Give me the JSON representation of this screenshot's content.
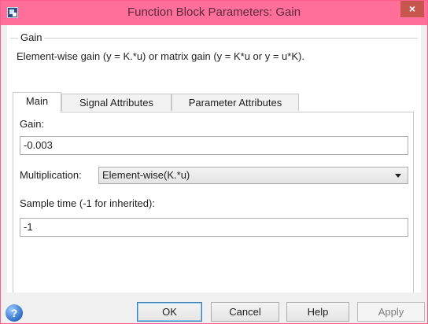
{
  "window": {
    "title": "Function Block Parameters: Gain",
    "close_glyph": "×"
  },
  "block": {
    "group_label": "Gain",
    "description": "Element-wise gain (y = K.*u) or matrix gain (y = K*u or y = u*K)."
  },
  "tabs": [
    {
      "label": "Main",
      "active": true
    },
    {
      "label": "Signal Attributes",
      "active": false
    },
    {
      "label": "Parameter Attributes",
      "active": false
    }
  ],
  "main": {
    "gain_label": "Gain:",
    "gain_value": "-0.003",
    "multiplication_label": "Multiplication:",
    "multiplication_value": "Element-wise(K.*u)",
    "sample_time_label": "Sample time (-1 for inherited):",
    "sample_time_value": "-1"
  },
  "footer": {
    "help_icon": "?",
    "ok_label": "OK",
    "cancel_label": "Cancel",
    "help_label": "Help",
    "apply_label": "Apply"
  },
  "colors": {
    "titlebar": "#ff6f9a",
    "close_button": "#c7564f",
    "accent": "#3c7fb1"
  },
  "icons": [
    "simulink-app-icon",
    "close-icon",
    "help-circle-icon",
    "chevron-down-icon"
  ]
}
